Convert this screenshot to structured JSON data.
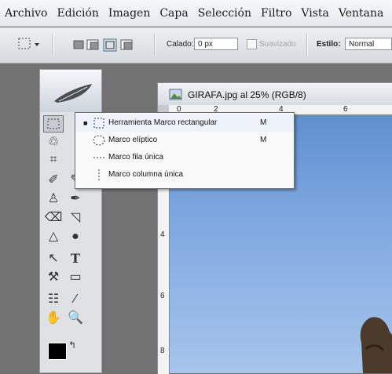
{
  "menu": [
    "Archivo",
    "Edición",
    "Imagen",
    "Capa",
    "Selección",
    "Filtro",
    "Vista",
    "Ventana"
  ],
  "options": {
    "tool_icon": "rect-marquee-icon",
    "feather_label": "Calado:",
    "feather_value": "0 px",
    "antialias_label": "Suavizado",
    "style_label": "Estilo:",
    "style_value": "Normal"
  },
  "document": {
    "title": "GIRAFA.jpg al 25% (RGB/8)",
    "ruler_top": [
      "0",
      "2",
      "4",
      "6"
    ],
    "ruler_left": [
      "4",
      "6",
      "8"
    ]
  },
  "flyout": {
    "items": [
      {
        "label": "Herramienta Marco rectangular",
        "shortcut": "M",
        "icon": "rect-marquee-icon",
        "selected": true
      },
      {
        "label": "Marco elíptico",
        "shortcut": "M",
        "icon": "ellipse-marquee-icon",
        "selected": false
      },
      {
        "label": "Marco fila única",
        "shortcut": "",
        "icon": "single-row-marquee-icon",
        "selected": false
      },
      {
        "label": "Marco columna única",
        "shortcut": "",
        "icon": "single-column-marquee-icon",
        "selected": false
      }
    ]
  },
  "toolbox": {
    "tools": [
      "rect-marquee-icon",
      "lasso-icon",
      "crop-icon",
      "healing-brush-icon",
      "brush-icon",
      "clone-stamp-icon",
      "history-brush-icon",
      "eraser-icon",
      "paint-bucket-icon",
      "dodge-icon",
      "burn-icon",
      "move-path-icon",
      "type-icon",
      "pen-icon",
      "shape-icon",
      "notes-icon",
      "eyedropper-icon",
      "hand-icon",
      "zoom-icon",
      "color-swatches-icon"
    ]
  }
}
